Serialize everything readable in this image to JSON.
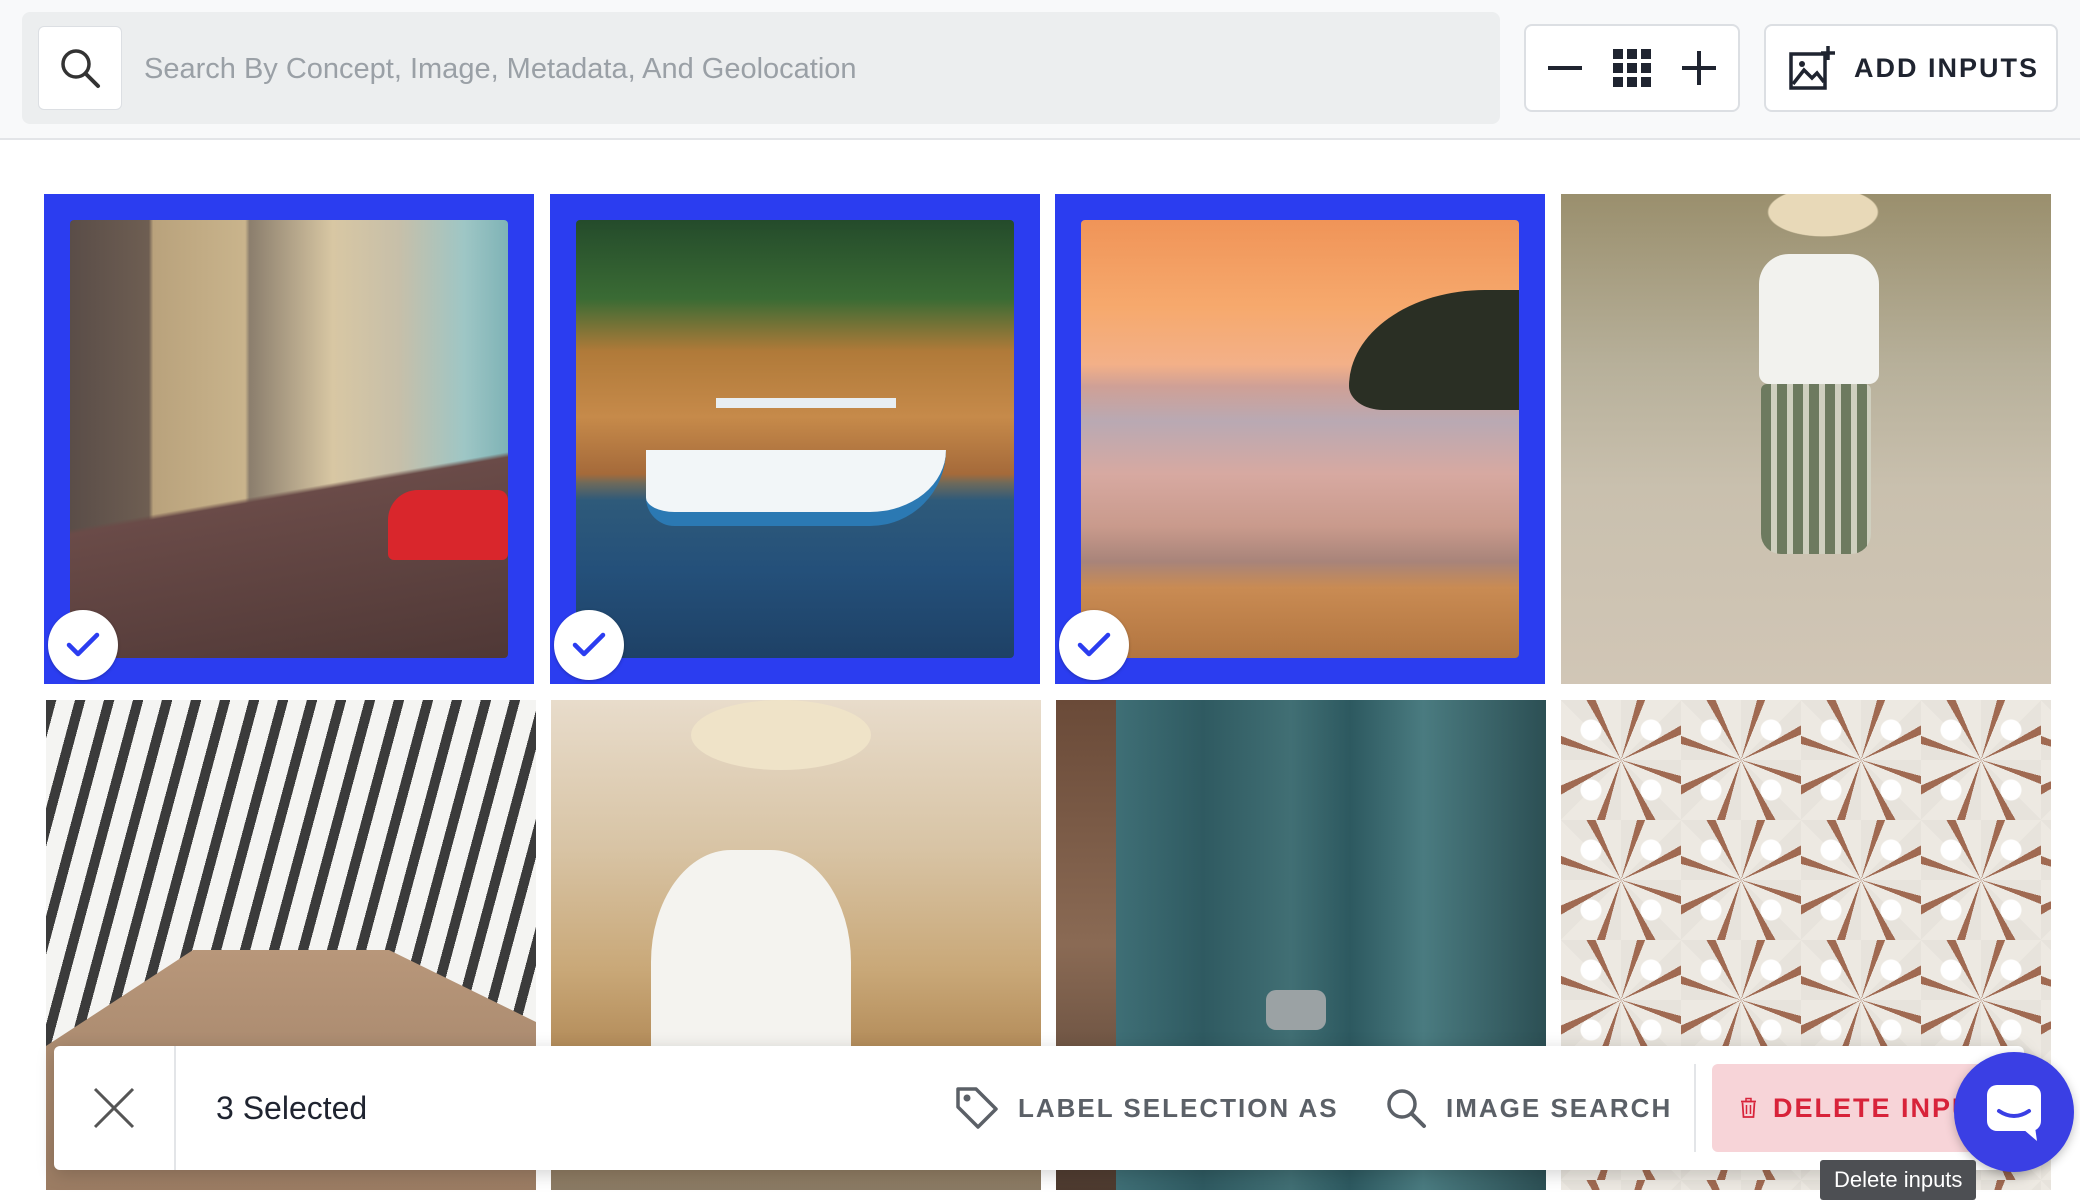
{
  "search": {
    "placeholder": "Search By Concept, Image, Metadata, And Geolocation",
    "value": ""
  },
  "toolbar": {
    "add_inputs_label": "ADD INPUTS",
    "icons": {
      "search": "search-icon",
      "zoom_out": "minus-icon",
      "grid": "grid-icon",
      "zoom_in": "plus-icon",
      "add_image": "add-image-icon"
    }
  },
  "grid": {
    "accent_color": "#2b3df0",
    "tiles": [
      {
        "subject": "street",
        "selected": true
      },
      {
        "subject": "boat",
        "selected": true
      },
      {
        "subject": "sunset",
        "selected": true
      },
      {
        "subject": "woman-walking",
        "selected": false
      },
      {
        "subject": "striped-pants",
        "selected": false
      },
      {
        "subject": "woman-white-dress",
        "selected": false
      },
      {
        "subject": "blue-door",
        "selected": false
      },
      {
        "subject": "mosaic-pattern",
        "selected": false
      }
    ]
  },
  "selection_bar": {
    "count_text": "3 Selected",
    "label_selection": "LABEL SELECTION AS",
    "image_search": "IMAGE SEARCH",
    "delete_label": "DELETE INPUTS",
    "delete_color": "#d8233a"
  },
  "tooltip": {
    "text": "Delete inputs"
  }
}
